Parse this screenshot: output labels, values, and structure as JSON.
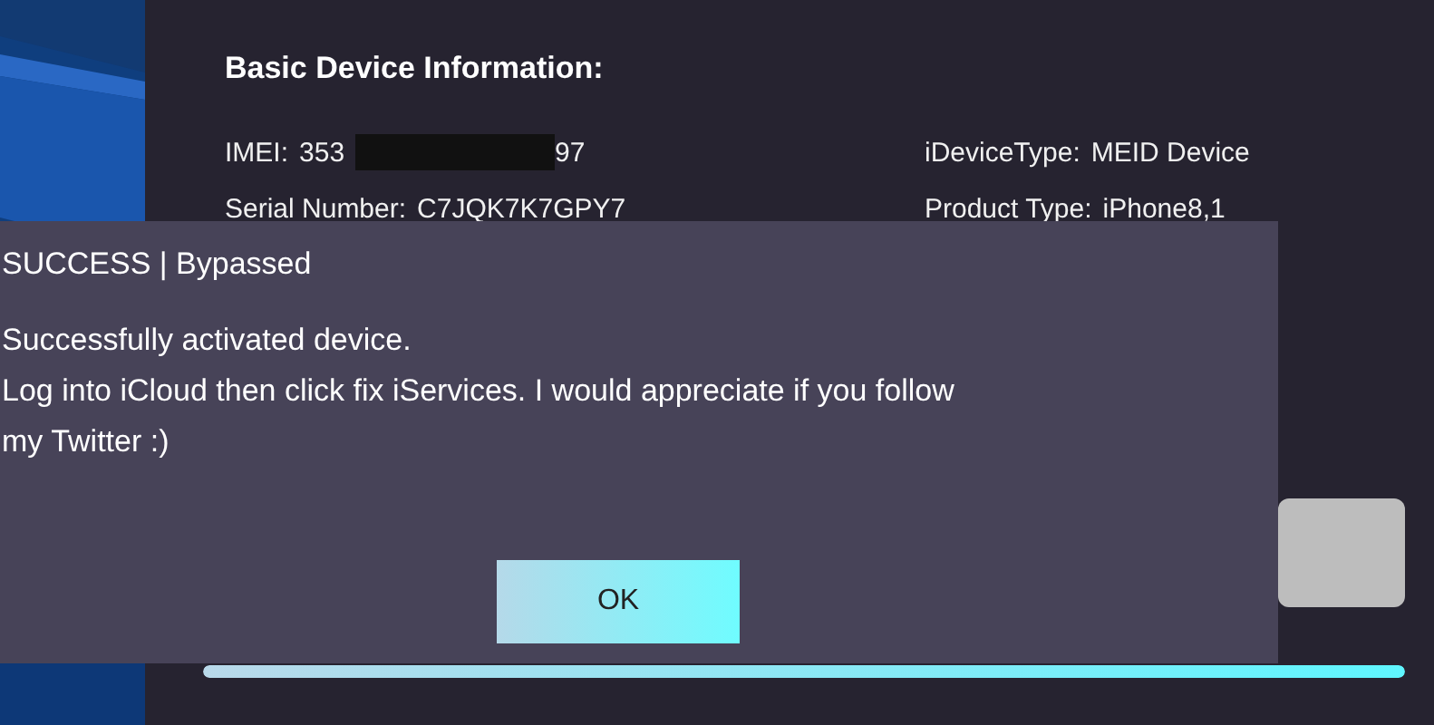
{
  "panel": {
    "title": "Basic Device Information:",
    "fields": [
      {
        "label": "IMEI:",
        "value_start": "353",
        "value_end": "97",
        "redacted": true
      },
      {
        "label": "iDeviceType:",
        "value_start": "MEID Device"
      },
      {
        "label": "Serial Number:",
        "value_start": "C7JQK7K7GPY7"
      },
      {
        "label": "Product Type:",
        "value_start": "iPhone8,1"
      }
    ],
    "progress": {
      "level": 1
    }
  },
  "dialog": {
    "title": "SUCCESS | Bypassed",
    "lines": [
      "Successfully activated device.",
      "Log into iCloud then click fix iServices. I would appreciate if you follow",
      "my Twitter :)"
    ],
    "button": "OK"
  }
}
